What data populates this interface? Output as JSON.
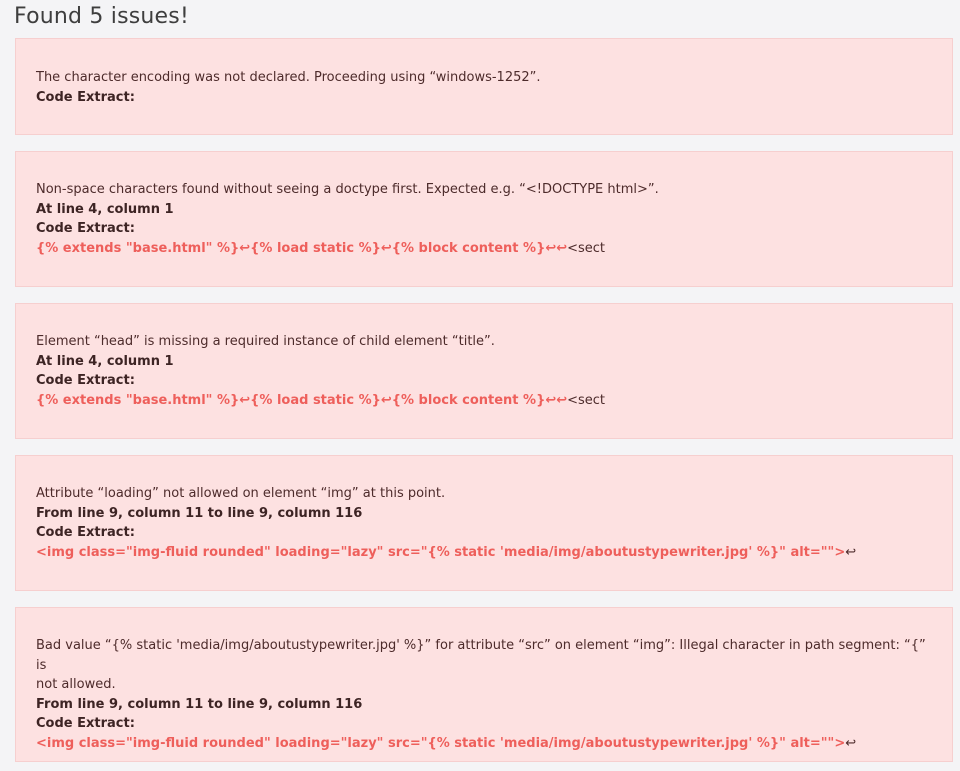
{
  "header": {
    "title": "Found 5 issues!"
  },
  "issues": [
    {
      "message": "The character encoding was not declared. Proceeding using “windows-1252”.",
      "code_label": "Code Extract:"
    },
    {
      "message": "Non-space characters found without seeing a doctype first. Expected e.g. “<!DOCTYPE html>”.",
      "location": "At line 4, column 1",
      "code_label": "Code Extract:",
      "code_highlight": "{% extends \"base.html\" %}↩{% load static %}↩{% block content %}↩↩",
      "code_tail": "<sect"
    },
    {
      "message": "Element “head” is missing a required instance of child element “title”.",
      "location": "At line 4, column 1",
      "code_label": "Code Extract:",
      "code_highlight": "{% extends \"base.html\" %}↩{% load static %}↩{% block content %}↩↩",
      "code_tail": "<sect"
    },
    {
      "message": "Attribute “loading” not allowed on element “img” at this point.",
      "location": "From line 9, column 11 to line 9, column 116",
      "code_label": "Code Extract:",
      "code_highlight": "<img class=\"img-fluid rounded\" loading=\"lazy\" src=\"{% static 'media/img/aboutustypewriter.jpg' %}\" alt=\"\">",
      "code_tail": "↩"
    },
    {
      "message_line1": "Bad value “{% static 'media/img/aboutustypewriter.jpg' %}” for attribute “src” on element “img”: Illegal character in path segment: “{” is",
      "message_line2": "not allowed.",
      "location": "From line 9, column 11 to line 9, column 116",
      "code_label": "Code Extract:",
      "code_highlight": "<img class=\"img-fluid rounded\" loading=\"lazy\" src=\"{% static 'media/img/aboutustypewriter.jpg' %}\" alt=\"\">",
      "code_tail": "↩"
    }
  ],
  "colors": {
    "card_background": "#fde1e1",
    "card_border": "#f6cfcf",
    "code_highlight": "#ee5f5b",
    "text": "#4d2b2b",
    "page_background": "#f4f4f6"
  }
}
